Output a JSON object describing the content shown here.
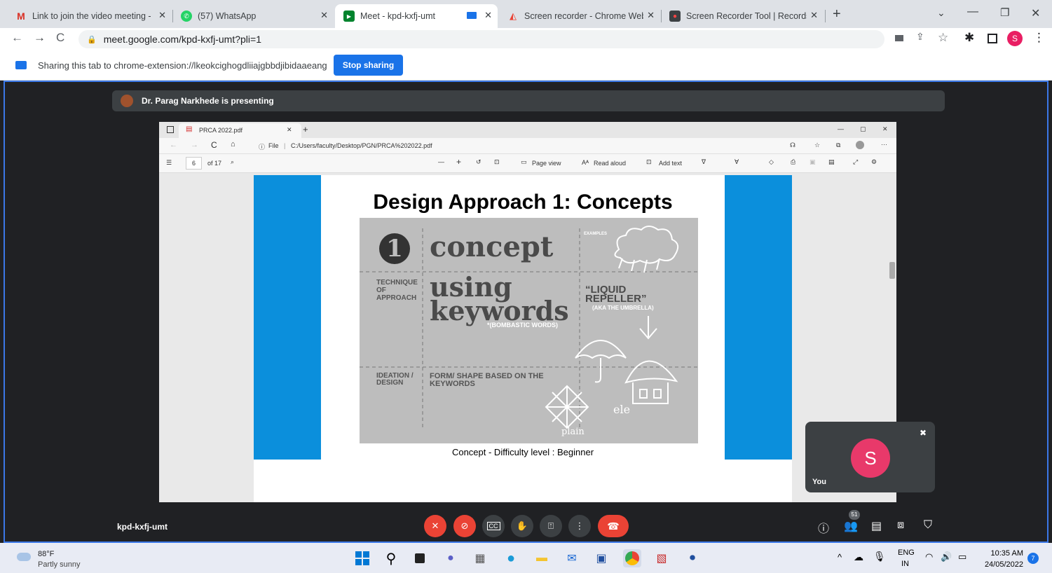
{
  "browser": {
    "tabs": [
      {
        "title": "Link to join the video meeting - ·",
        "icon": "gmail-icon"
      },
      {
        "title": "(57) WhatsApp",
        "icon": "whatsapp-icon"
      },
      {
        "title": "Meet - kpd-kxfj-umt",
        "icon": "meet-icon"
      },
      {
        "title": "Screen recorder - Chrome Web S",
        "icon": "webstore-icon"
      },
      {
        "title": "Screen Recorder Tool | Records S",
        "icon": "recorder-icon"
      }
    ],
    "url": "meet.google.com/kpd-kxfj-umt?pli=1",
    "profile_initial": "S"
  },
  "share_bar": {
    "message": "Sharing this tab to chrome-extension://lkeokcighogdliiajgbbdjibidaaeang",
    "stop_label": "Stop sharing"
  },
  "meet": {
    "presenter_text": "Dr. Parag Narkhede is presenting",
    "meeting_code": "kpd-kxfj-umt",
    "self_label": "You",
    "self_initial": "S",
    "participants_count": "51"
  },
  "pdf": {
    "tab_title": "PRCA 2022.pdf",
    "address_prefix": "File",
    "address": "C:/Users/faculty/Desktop/PGN/PRCA%202022.pdf",
    "page_num": "6",
    "page_total": "of 17",
    "page_view_label": "Page view",
    "read_aloud_label": "Read aloud",
    "add_text_label": "Add text",
    "slide": {
      "title": "Design Approach 1: Concepts",
      "caption": "Concept - Difficulty level : Beginner",
      "number": "1",
      "concept_word": "concept",
      "examples_label": "EXAMPLES",
      "technique_label": "TECHNIQUE OF APPROACH",
      "using_word": "using",
      "keywords_word": "keywords",
      "bombastic_label": "*(BOMBASTIC WORDS)",
      "liquid_label": "“LIQUID REPELLER”",
      "umbrella_label": "(AKA THE UMBRELLA)",
      "ideation_label": "IDEATION / DESIGN",
      "form_label": "FORM/ SHAPE BASED ON THE KEYWORDS",
      "ele_label": "ele",
      "plain_label": "plain"
    }
  },
  "taskbar": {
    "temperature": "88°F",
    "weather": "Partly sunny",
    "lang": "ENG",
    "region": "IN",
    "time": "10:35 AM",
    "date": "24/05/2022",
    "notif_count": "7"
  }
}
